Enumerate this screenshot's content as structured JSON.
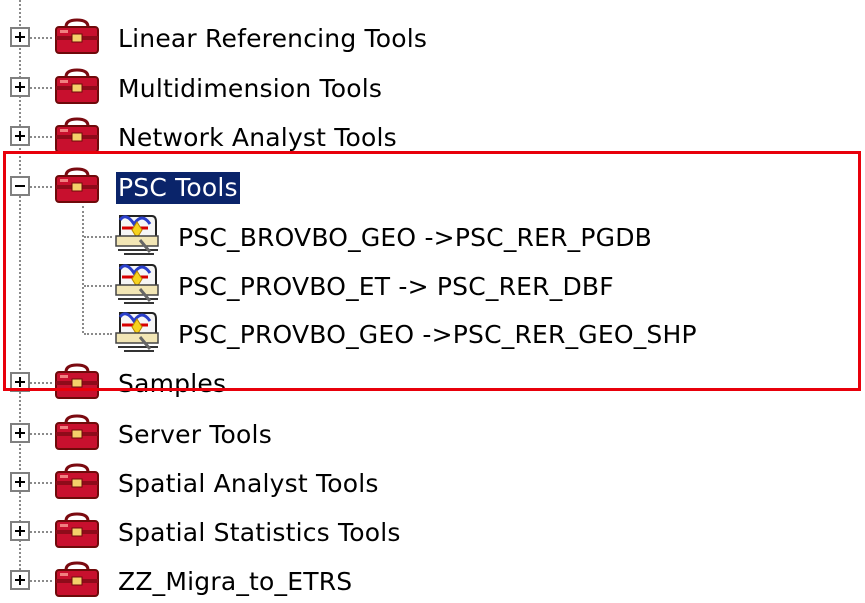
{
  "tree": {
    "items": [
      {
        "label": "Linear Referencing Tools",
        "icon": "toolbox-icon",
        "state": "collapsed"
      },
      {
        "label": "Multidimension Tools",
        "icon": "toolbox-icon",
        "state": "collapsed"
      },
      {
        "label": "Network Analyst Tools",
        "icon": "toolbox-icon",
        "state": "collapsed"
      },
      {
        "label": "PSC Tools",
        "icon": "toolbox-icon",
        "state": "expanded",
        "selected": true
      },
      {
        "label": "PSC_BROVBO_GEO ->PSC_RER_PGDB",
        "icon": "script-tool-icon",
        "child": true
      },
      {
        "label": "PSC_PROVBO_ET -> PSC_RER_DBF",
        "icon": "script-tool-icon",
        "child": true
      },
      {
        "label": "PSC_PROVBO_GEO ->PSC_RER_GEO_SHP",
        "icon": "script-tool-icon",
        "child": true
      },
      {
        "label": "Samples",
        "icon": "toolbox-icon",
        "state": "collapsed"
      },
      {
        "label": "Server Tools",
        "icon": "toolbox-icon",
        "state": "collapsed"
      },
      {
        "label": "Spatial Analyst Tools",
        "icon": "toolbox-icon",
        "state": "collapsed"
      },
      {
        "label": "Spatial Statistics Tools",
        "icon": "toolbox-icon",
        "state": "collapsed"
      },
      {
        "label": "ZZ_Migra_to_ETRS",
        "icon": "toolbox-icon",
        "state": "collapsed"
      }
    ]
  },
  "colors": {
    "selection": "#0a246a",
    "highlight_box": "#e8000b",
    "toolbox_red": "#c8102e"
  }
}
